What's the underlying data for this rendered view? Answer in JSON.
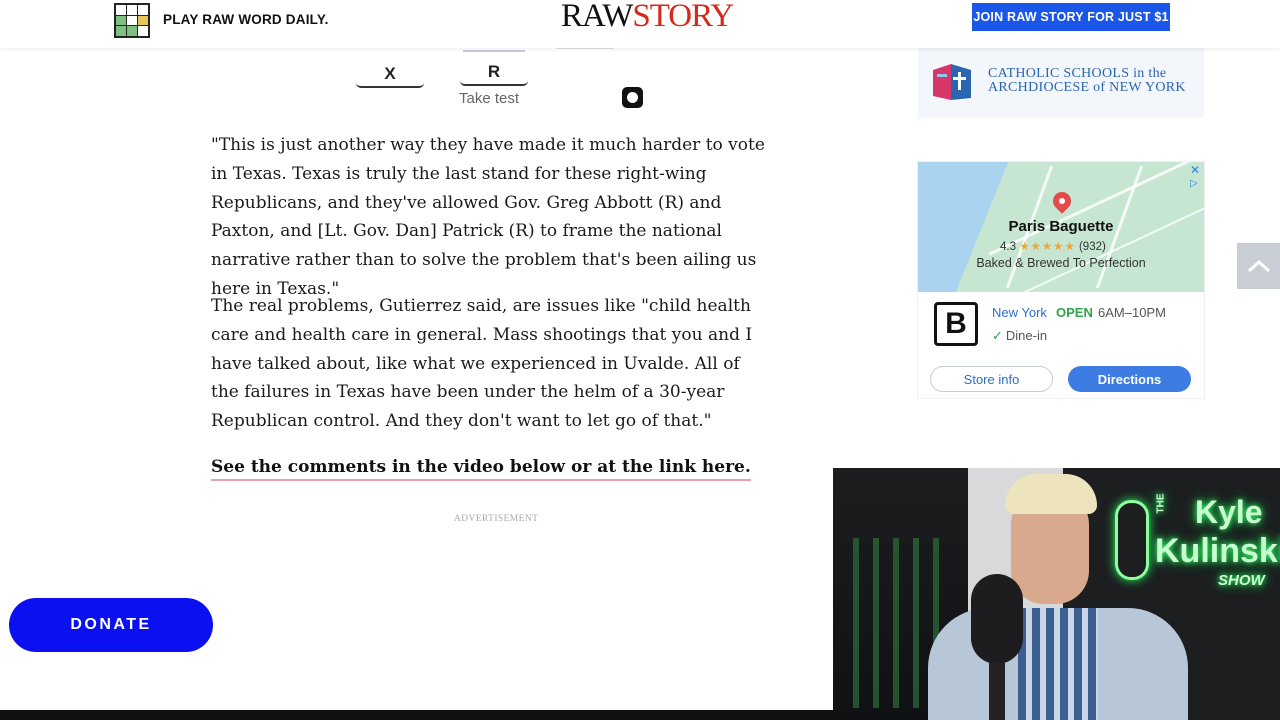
{
  "header": {
    "game_label": "PLAY RAW WORD DAILY.",
    "logo_part1": "RAW",
    "logo_part2": "STORY",
    "join_button": "JOIN RAW STORY FOR JUST $1"
  },
  "embed": {
    "box_x": "X",
    "box_r": "R",
    "take_test": "Take test"
  },
  "article": {
    "paragraphs": [
      "\"This is just another way they have made it much harder to vote in Texas. Texas is truly the last stand for these right-wing Republicans, and they've allowed Gov. Greg Abbott (R) and Paxton, and [Lt. Gov. Dan] Patrick (R) to frame the national narrative rather than to solve the problem that's been ailing us here in Texas.\"",
      "The real problems, Gutierrez said, are issues like \"child health care and health care in general. Mass shootings that you and I have talked about, like what we experienced in Uvalde. All of the failures in Texas have been under the helm of a 30-year Republican control. And they don't want to let go of that.\""
    ],
    "link_text": "See the comments in the video below or at the link here.",
    "advertisement_label": "ADVERTISEMENT"
  },
  "ads": {
    "catholic": {
      "line1": "CATHOLIC SCHOOLS in the",
      "line2": "ARCHDIOCESE of NEW YORK"
    },
    "map_ad": {
      "place_name": "Paris Baguette",
      "rating": "4.3",
      "stars": "★★★★★",
      "review_count": "(932)",
      "tagline": "Baked & Brewed To Perfection",
      "location": "New York",
      "status": "OPEN",
      "hours": "6AM–10PM",
      "dine_in": "Dine-in",
      "store_info_button": "Store info",
      "directions_button": "Directions",
      "close_glyph": "✕",
      "adchoices_glyph": "▷"
    }
  },
  "donate": {
    "label": "DONATE"
  },
  "webcam": {
    "neon_the": "THE",
    "neon_line1": "Kyle",
    "neon_line2": "Kulinski",
    "neon_line3": "SHOW"
  },
  "colors": {
    "accent_blue": "#1a57e8",
    "logo_red": "#d6281b",
    "donate_blue": "#0b10f0",
    "neon_green": "#36ff6b"
  }
}
